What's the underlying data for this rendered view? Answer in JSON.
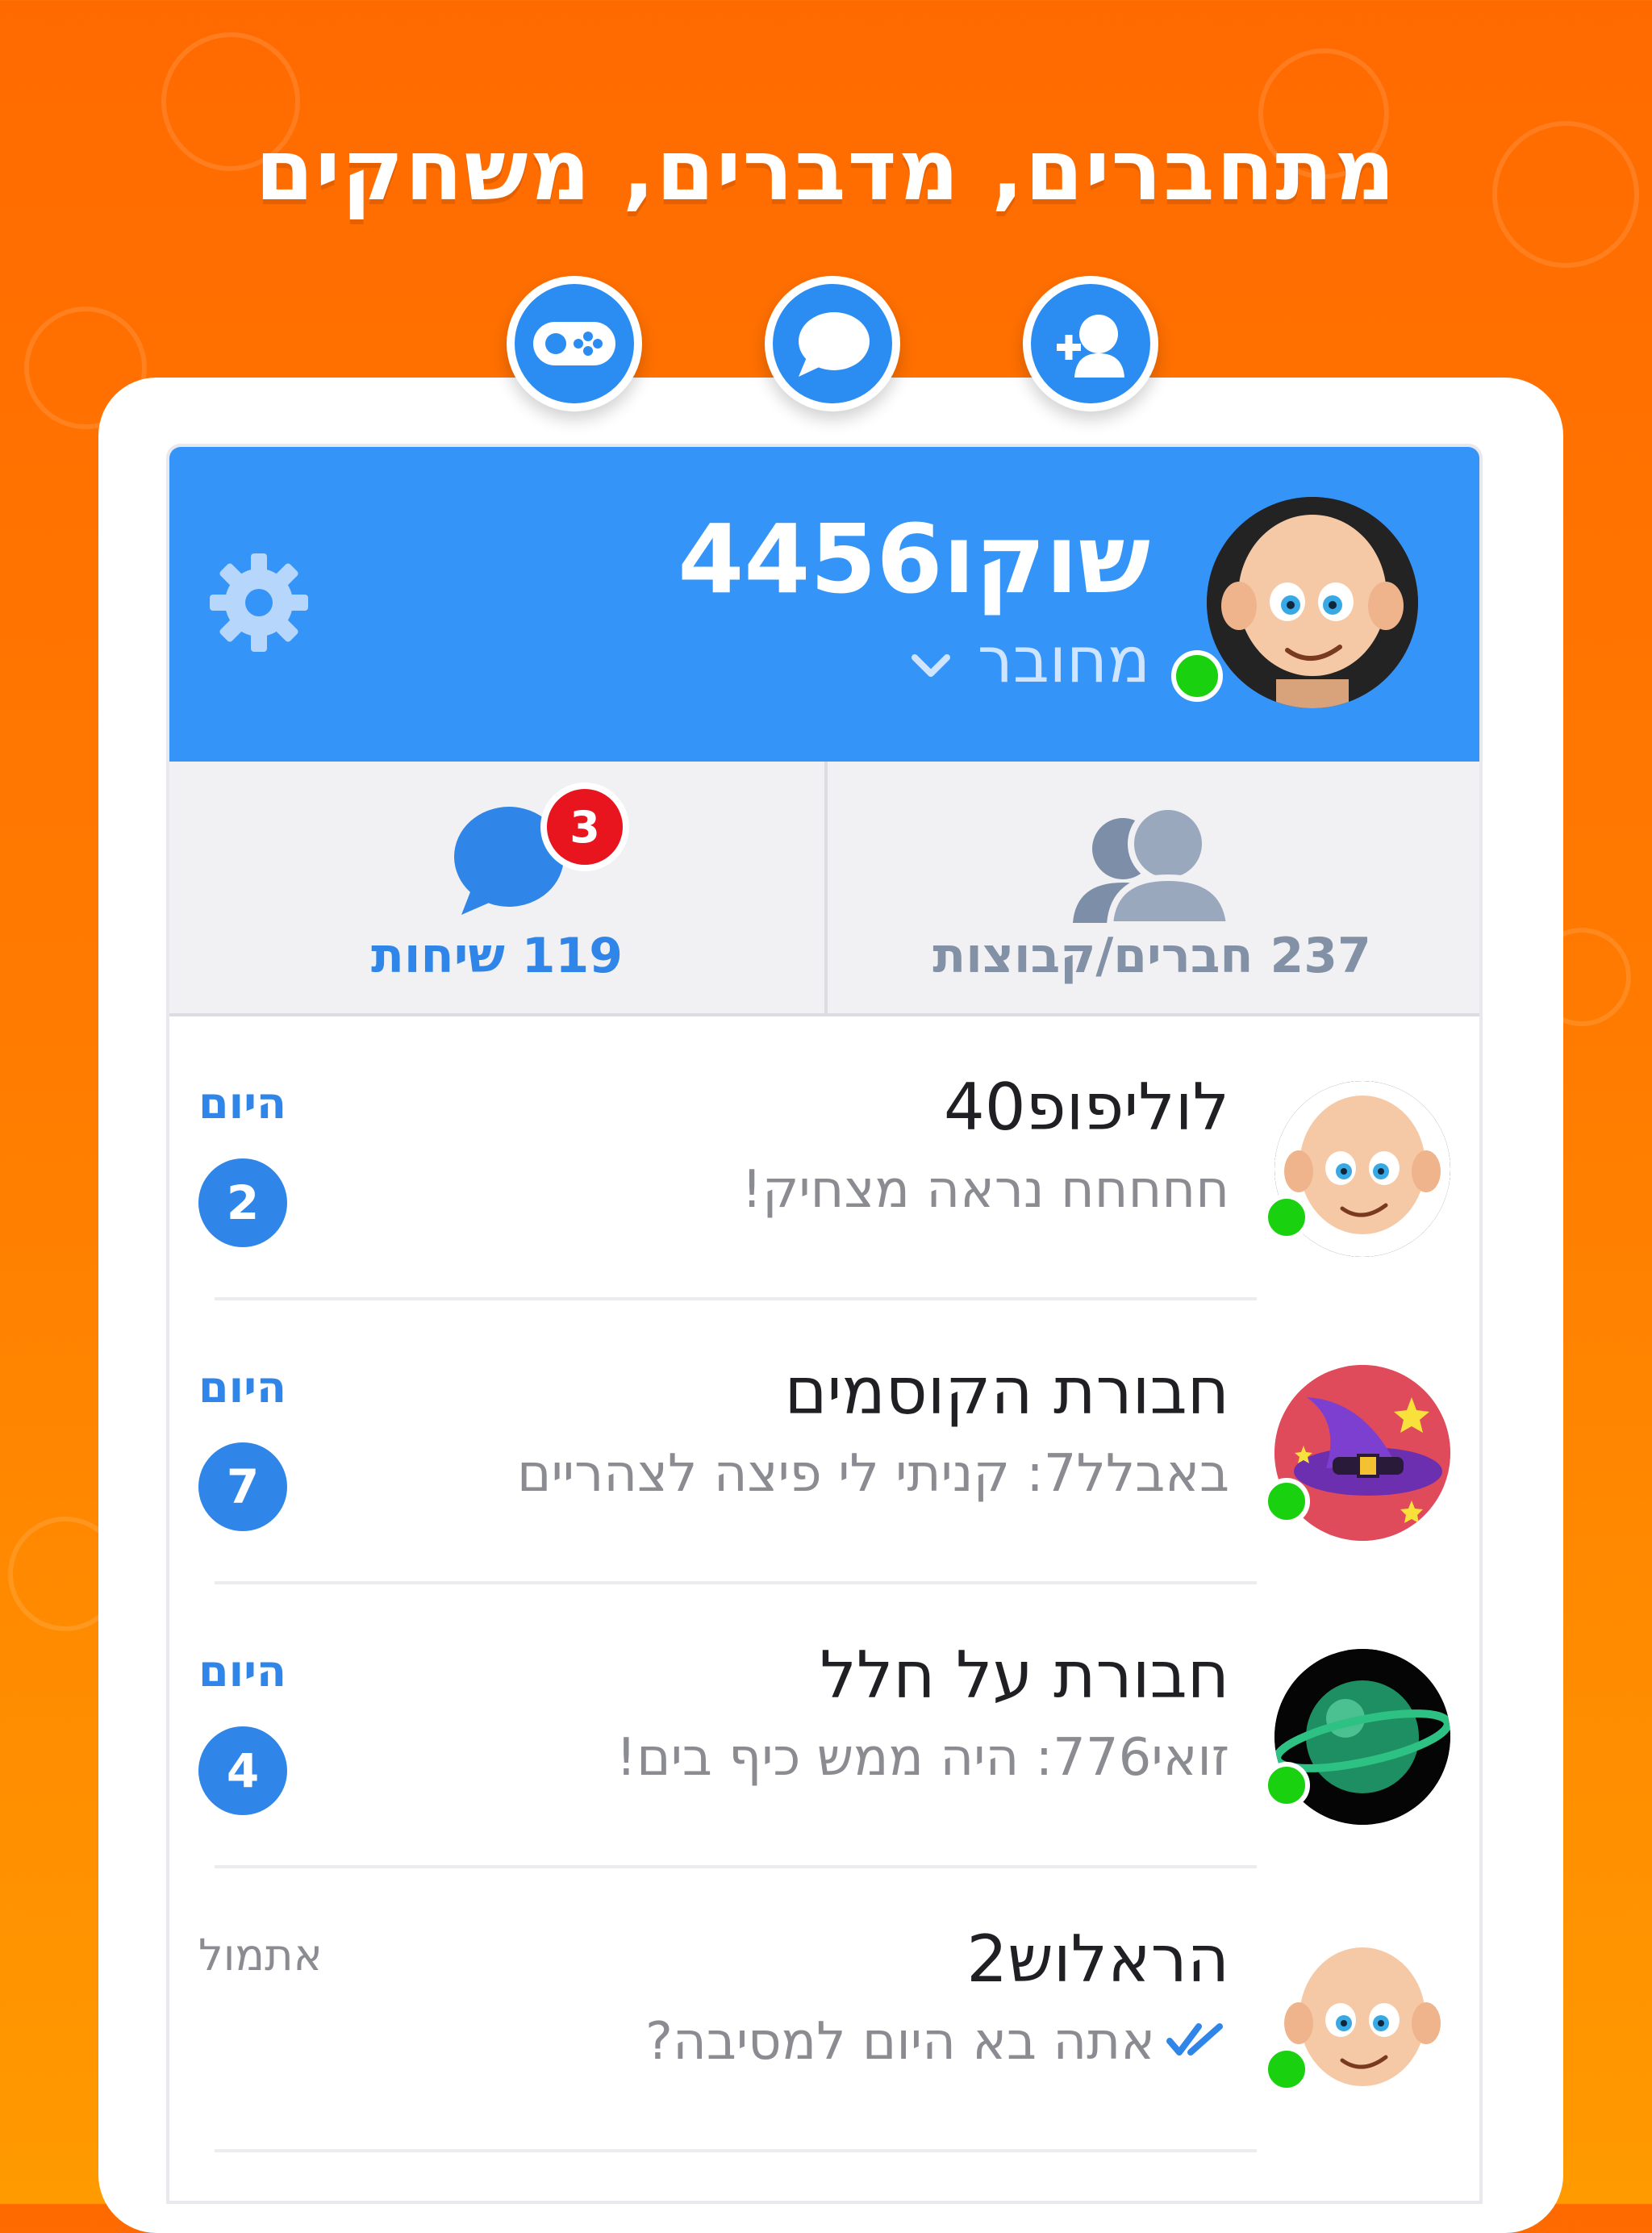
{
  "headline": "מתחברים, מדברים, משחקים",
  "feature_icons": [
    "gamepad-icon",
    "chat-bubble-icon",
    "add-friend-icon"
  ],
  "colors": {
    "background_top": "#ff6a00",
    "background_bottom": "#ff9a00",
    "header_blue": "#3494f7",
    "accent_blue": "#2f86e8",
    "online_green": "#19d10f",
    "badge_red": "#e8141e"
  },
  "profile": {
    "username": "שוקו4456",
    "status": "מחובר",
    "online": true
  },
  "tabs": {
    "friends_label": "237 חברים/קבוצות",
    "chats_label": "119 שיחות",
    "chats_badge": "3"
  },
  "chats": [
    {
      "name": "לוליפופ40",
      "message": "חחחחח נראה מצחיק!",
      "time": "היום",
      "unread": "2",
      "avatar": "baby-avatar",
      "online": true
    },
    {
      "name": "חבורת הקוסמים",
      "message": "באבלל7: קניתי לי פיצה לצהריים",
      "time": "היום",
      "unread": "7",
      "avatar": "wizard-hat-avatar",
      "online": true
    },
    {
      "name": "חבורת על חלל",
      "message": "זואי776: היה ממש כיף בים!",
      "time": "היום",
      "unread": "4",
      "avatar": "planet-avatar",
      "online": true
    },
    {
      "name": "הראלוש2",
      "message": "אתה בא היום למסיבה?",
      "time": "אתמול",
      "unread": "",
      "avatar": "baby-avatar",
      "online": true,
      "read_receipt": "double-check-icon"
    }
  ]
}
